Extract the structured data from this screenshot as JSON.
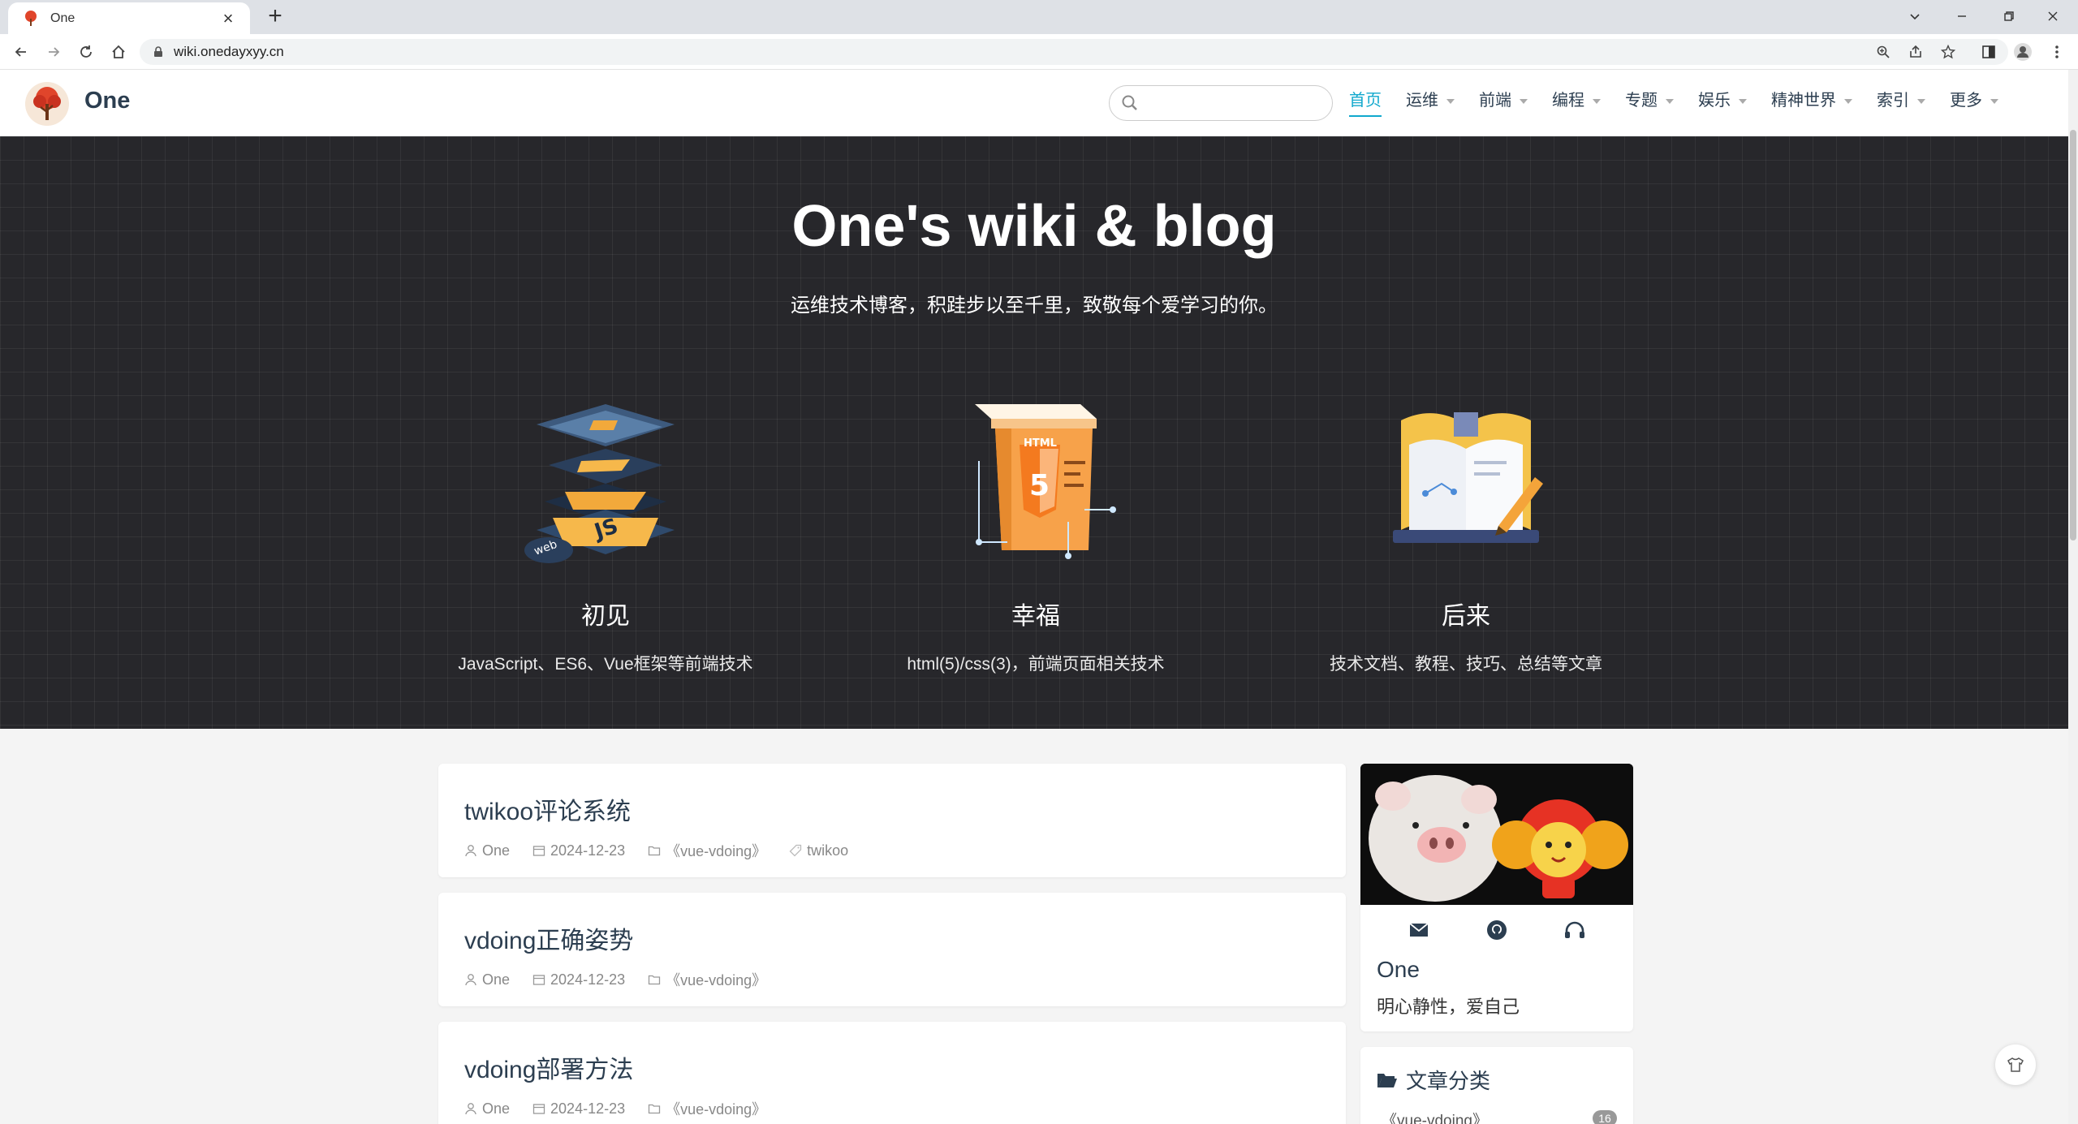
{
  "browser": {
    "tab_title": "One",
    "url": "wiki.onedayxyy.cn"
  },
  "site": {
    "name": "One",
    "search_placeholder": "",
    "nav": [
      {
        "label": "首页",
        "active": true,
        "dropdown": false
      },
      {
        "label": "运维",
        "active": false,
        "dropdown": true
      },
      {
        "label": "前端",
        "active": false,
        "dropdown": true
      },
      {
        "label": "编程",
        "active": false,
        "dropdown": true
      },
      {
        "label": "专题",
        "active": false,
        "dropdown": true
      },
      {
        "label": "娱乐",
        "active": false,
        "dropdown": true
      },
      {
        "label": "精神世界",
        "active": false,
        "dropdown": true
      },
      {
        "label": "索引",
        "active": false,
        "dropdown": true
      },
      {
        "label": "更多",
        "active": false,
        "dropdown": true
      }
    ]
  },
  "hero": {
    "title": "One's wiki & blog",
    "description": "运维技术博客，积跬步以至千里，致敬每个爱学习的你。",
    "features": [
      {
        "title": "初见",
        "desc": "JavaScript、ES6、Vue框架等前端技术",
        "icon": "js-layers-icon"
      },
      {
        "title": "幸福",
        "desc": "html(5)/css(3)，前端页面相关技术",
        "icon": "html5-panel-icon"
      },
      {
        "title": "后来",
        "desc": "技术文档、教程、技巧、总结等文章",
        "icon": "open-book-icon"
      }
    ]
  },
  "posts": [
    {
      "title": "twikoo评论系统",
      "author": "One",
      "date": "2024-12-23",
      "category": "《vue-vdoing》",
      "tag": "twikoo"
    },
    {
      "title": "vdoing正确姿势",
      "author": "One",
      "date": "2024-12-23",
      "category": "《vue-vdoing》",
      "tag": ""
    },
    {
      "title": "vdoing部署方法",
      "author": "One",
      "date": "2024-12-23",
      "category": "《vue-vdoing》",
      "tag": ""
    }
  ],
  "profile": {
    "name": "One",
    "bio": "明心静性，爱自己"
  },
  "categories": {
    "title": "文章分类",
    "items": [
      {
        "label": "《vue-vdoing》",
        "count": "16"
      }
    ]
  },
  "colors": {
    "accent": "#11a8cd",
    "hero_bg": "#27272b",
    "text_dark": "#2c3e50"
  }
}
